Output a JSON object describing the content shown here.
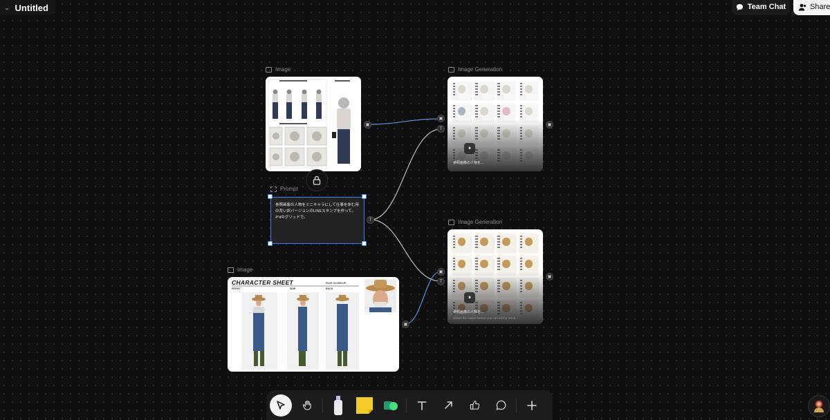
{
  "header": {
    "title": "Untitled"
  },
  "actions": {
    "team_chat": "Team Chat",
    "share": "Share"
  },
  "nodes": {
    "image_top": {
      "label": "Image"
    },
    "prompt": {
      "label": "Prompt",
      "text": "参照画像の人物をミニキャラにして仕事を休む用の背い訳バージョンのLINEスタンプを作って。4*4のグリッドで。"
    },
    "image_bottom": {
      "label": "Image",
      "sheet_title": "CHARACTER SHEET",
      "front": "FRONT",
      "side": "SIDE",
      "back": "BACK",
      "face": "FACE CLOSE-UP"
    },
    "gen_top": {
      "label": "Image Generation",
      "caption": "参照画像の人物を..."
    },
    "gen_bottom": {
      "label": "Image Generation",
      "caption": "参照画像の人物を...",
      "hint": "Select the output before you can edit or rerun"
    }
  },
  "colors": {
    "accent": "#3b82f6",
    "canvas": "#0f0f10",
    "wire": "#9aa4b2"
  },
  "icons": {
    "team_chat": "chat-bubble-icon",
    "share": "users-icon",
    "lock": "lock-icon",
    "toolbar": [
      "pointer-icon",
      "hand-icon",
      "spray-bottle-icon",
      "sticky-note-icon",
      "shapes-icon",
      "text-icon",
      "arrow-icon",
      "thumbs-up-icon",
      "comment-icon",
      "plus-icon"
    ]
  }
}
